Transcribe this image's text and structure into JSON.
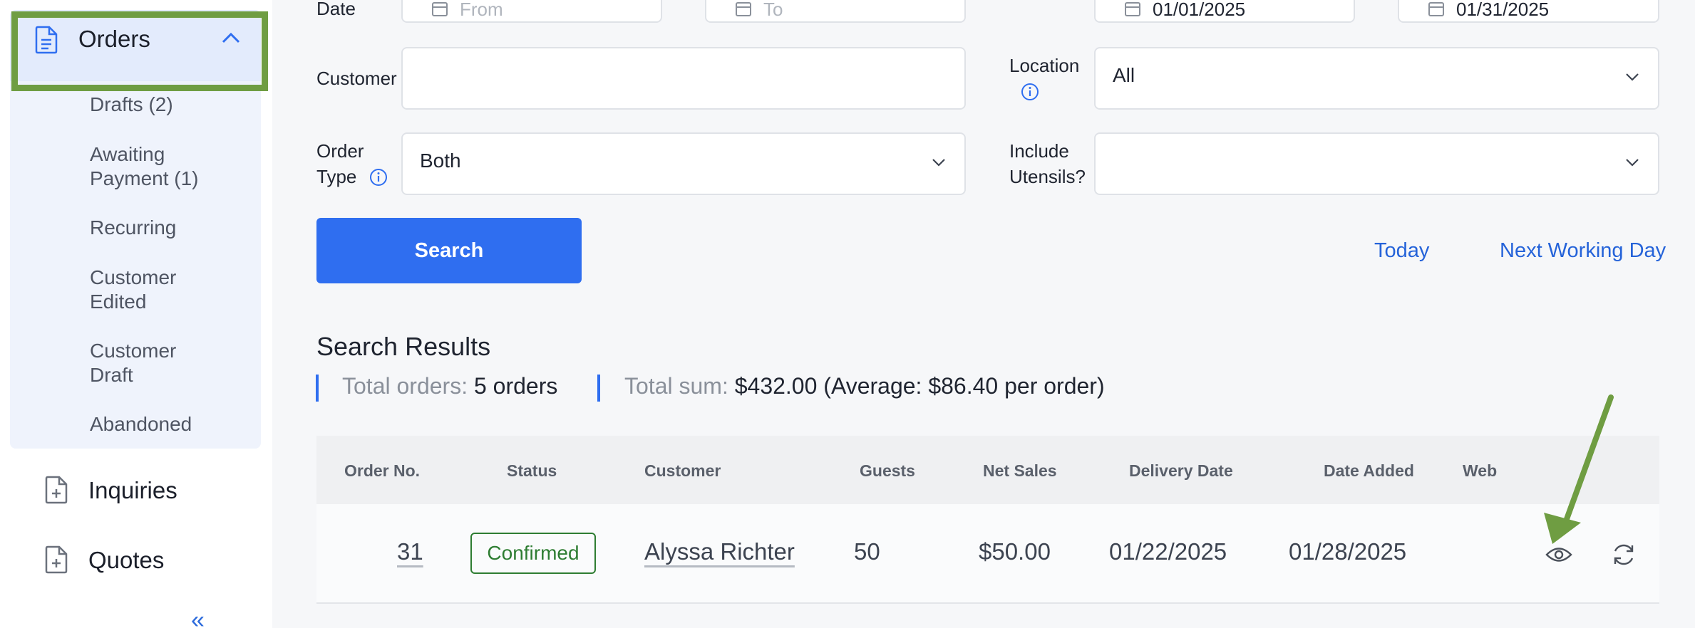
{
  "sidebar": {
    "orders_label": "Orders",
    "sub_items": [
      {
        "label": "Drafts (2)"
      },
      {
        "label": "Awaiting\nPayment (1)"
      },
      {
        "label": "Recurring"
      },
      {
        "label": "Customer\nEdited"
      },
      {
        "label": "Customer\nDraft"
      },
      {
        "label": "Abandoned"
      }
    ],
    "inquiries_label": "Inquiries",
    "quotes_label": "Quotes",
    "collapse_icon": "double-chevron-left-icon"
  },
  "filters": {
    "date_label": "Date",
    "date_from_placeholder": "From",
    "date_to_placeholder": "To",
    "date_field_3_value": "01/01/2025",
    "date_field_4_value": "01/31/2025",
    "customer_label": "Customer",
    "customer_value": "",
    "location_label": "Location",
    "location_value": "All",
    "order_type_label_line1": "Order",
    "order_type_label_line2": "Type",
    "order_type_value": "Both",
    "utensils_label_line1": "Include",
    "utensils_label_line2": "Utensils?",
    "utensils_value": "",
    "search_button": "Search",
    "today_link": "Today",
    "next_working_day_link": "Next Working Day"
  },
  "results": {
    "title": "Search Results",
    "total_orders_label": "Total orders:",
    "total_orders_value": "5 orders",
    "total_sum_label": "Total sum:",
    "total_sum_value": "$432.00 (Average: $86.40 per order)"
  },
  "table": {
    "headers": [
      "Order No.",
      "Status",
      "Customer",
      "Guests",
      "Net Sales",
      "Delivery Date",
      "Date Added",
      "Web"
    ],
    "rows": [
      {
        "order_no": "31",
        "status": "Confirmed",
        "customer": "Alyssa Richter",
        "guests": "50",
        "net_sales": "$50.00",
        "delivery_date": "01/22/2025",
        "date_added": "01/28/2025",
        "actions": [
          "eye-icon",
          "refresh-icon"
        ]
      }
    ]
  },
  "colors": {
    "accent": "#2f6ef0",
    "highlight": "#6f9d42",
    "status_confirmed": "#2e7d32"
  }
}
